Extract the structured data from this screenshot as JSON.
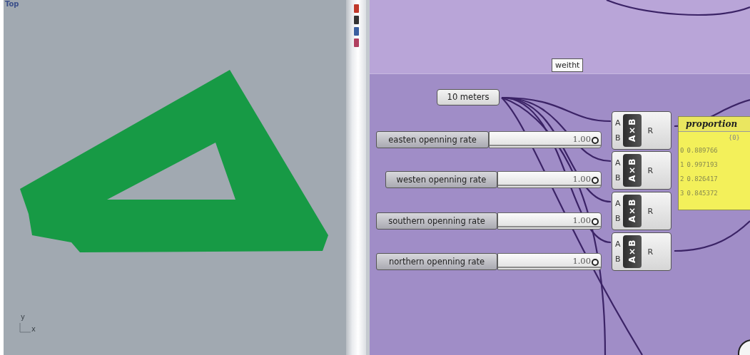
{
  "viewport": {
    "label": "Top",
    "axis_y": "y",
    "axis_x": "x"
  },
  "canvas": {
    "tooltip": "weitht",
    "number_param": "10 meters",
    "sliders": [
      {
        "label": "easten openning rate",
        "value": "1.00",
        "level": 1
      },
      {
        "label": "westen openning rate",
        "value": "1.00",
        "level": 1
      },
      {
        "label": "southern openning rate",
        "value": "1.00",
        "level": 1
      },
      {
        "label": "northern openning rate",
        "value": "1.00",
        "level": 1
      }
    ],
    "components": [
      {
        "input_a": "A",
        "input_b": "B",
        "operator": "A×B",
        "output": "R"
      },
      {
        "input_a": "A",
        "input_b": "B",
        "operator": "A×B",
        "output": "R"
      },
      {
        "input_a": "A",
        "input_b": "B",
        "operator": "A×B",
        "output": "R"
      },
      {
        "input_a": "A",
        "input_b": "B",
        "operator": "A×B",
        "output": "R"
      }
    ],
    "panel": {
      "title": "proportion",
      "path": "{0}",
      "rows": [
        {
          "index": "0",
          "value": "0.889766"
        },
        {
          "index": "1",
          "value": "0.997193"
        },
        {
          "index": "2",
          "value": "0.826417"
        },
        {
          "index": "3",
          "value": "0.845372"
        }
      ]
    }
  }
}
